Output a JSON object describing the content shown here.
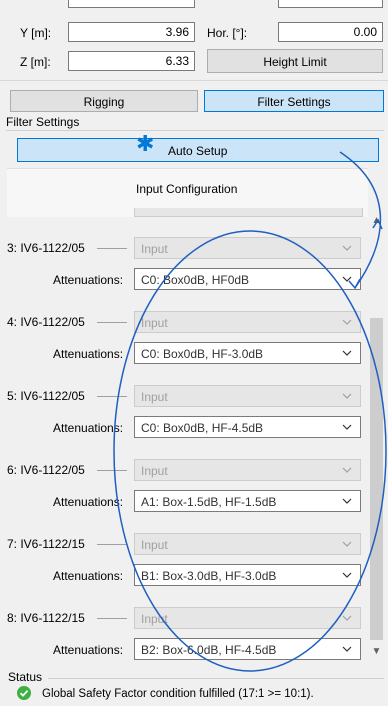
{
  "top": {
    "y_label": "Y [m]:",
    "y_value": "3.96",
    "z_label": "Z [m]:",
    "z_value": "6.33",
    "hor_label": "Hor. [°]:",
    "hor_value": "0.00",
    "height_limit": "Height Limit"
  },
  "tabs": {
    "rigging": "Rigging",
    "filter": "Filter Settings"
  },
  "filter_group": "Filter Settings",
  "auto_setup": "Auto Setup",
  "input_config": "Input Configuration",
  "attenuations_label": "Attenuations:",
  "input_placeholder": "Input",
  "channels": [
    {
      "name": "3: IV6-1122/05",
      "attenuation": "C0: Box0dB, HF0dB"
    },
    {
      "name": "4: IV6-1122/05",
      "attenuation": "C0: Box0dB, HF-3.0dB"
    },
    {
      "name": "5: IV6-1122/05",
      "attenuation": "C0: Box0dB, HF-4.5dB"
    },
    {
      "name": "6: IV6-1122/05",
      "attenuation": "A1: Box-1.5dB, HF-1.5dB"
    },
    {
      "name": "7: IV6-1122/15",
      "attenuation": "B1: Box-3.0dB, HF-3.0dB"
    },
    {
      "name": "8: IV6-1122/15",
      "attenuation": "B2: Box-6.0dB, HF-4.5dB"
    }
  ],
  "status": {
    "label": "Status",
    "message": "Global Safety Factor condition fulfilled (17:1 >= 10:1)."
  },
  "colors": {
    "accent": "#0078d7",
    "ok": "#3cb043",
    "annotation": "#1f5fbf"
  }
}
